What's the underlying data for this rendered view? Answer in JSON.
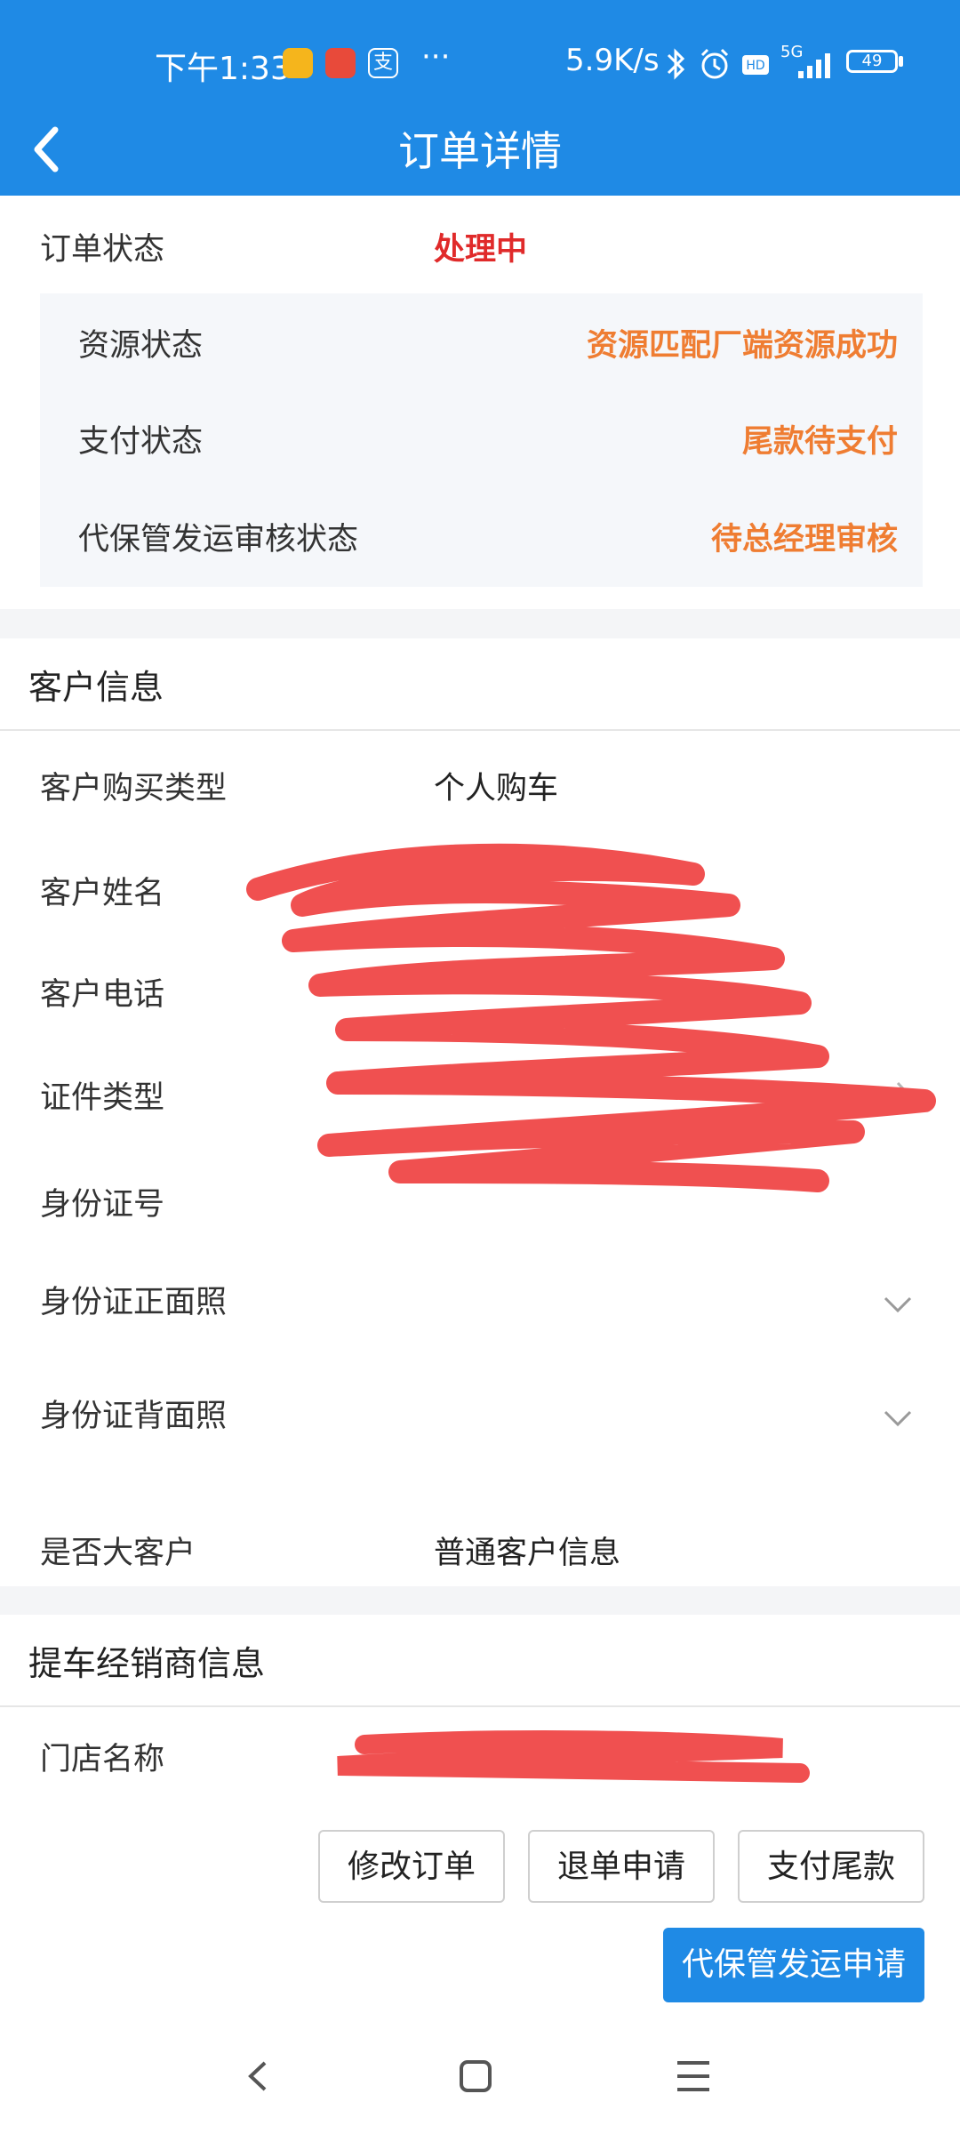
{
  "status_bar": {
    "time": "下午1:33",
    "more": "···",
    "net_speed": "5.9K/s",
    "signal_label": "5G",
    "battery": "49"
  },
  "header": {
    "title": "订单详情"
  },
  "order": {
    "status_label": "订单状态",
    "status_value": "处理中",
    "sub_rows": [
      {
        "label": "资源状态",
        "value": "资源匹配厂端资源成功"
      },
      {
        "label": "支付状态",
        "value": "尾款待支付"
      },
      {
        "label": "代保管发运审核状态",
        "value": "待总经理审核"
      }
    ]
  },
  "customer": {
    "section_title": "客户信息",
    "rows": [
      {
        "label": "客户购买类型",
        "value": "个人购车"
      },
      {
        "label": "客户姓名",
        "value": ""
      },
      {
        "label": "客户电话",
        "value": ""
      },
      {
        "label": "证件类型",
        "value": ""
      },
      {
        "label": "身份证号",
        "value": ""
      },
      {
        "label": "身份证正面照",
        "value": ""
      },
      {
        "label": "身份证背面照",
        "value": ""
      },
      {
        "label": "是否大客户",
        "value": "普通客户信息"
      }
    ]
  },
  "dealer": {
    "section_title": "提车经销商信息",
    "rows": [
      {
        "label": "门店名称",
        "value": ""
      }
    ]
  },
  "actions": {
    "modify": "修改订单",
    "refund": "退单申请",
    "pay_balance": "支付尾款",
    "custody_shipping": "代保管发运申请"
  },
  "colors": {
    "header_bg": "#1f8ae5",
    "status_red": "#e02a2a",
    "status_orange": "#ef7d32",
    "scribble": "#f05050"
  }
}
